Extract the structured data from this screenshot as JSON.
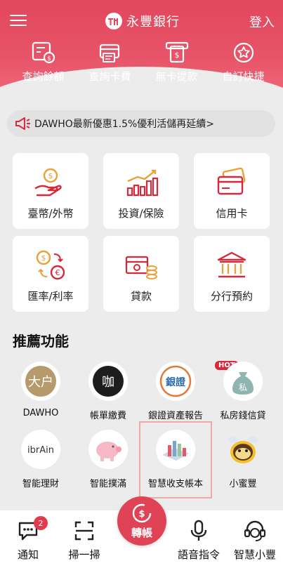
{
  "header": {
    "brand_name": "永豐銀行",
    "login_label": "登入",
    "icons": {
      "menu": "hamburger-menu-icon",
      "logo": "bank-logo-icon"
    }
  },
  "quick_actions": [
    {
      "label": "查詢餘額",
      "icon": "balance-coins-icon"
    },
    {
      "label": "查詢卡費",
      "icon": "card-bill-icon"
    },
    {
      "label": "無卡提款",
      "icon": "cardless-atm-icon"
    },
    {
      "label": "自訂快捷",
      "icon": "star-shortcut-icon"
    }
  ],
  "notice": {
    "text": "DAWHO最新優惠1.5%優利活儲再延續>",
    "icon": "megaphone-icon"
  },
  "services": [
    {
      "label": "臺幣/外幣",
      "icon": "hand-coin-icon"
    },
    {
      "label": "投資/保險",
      "icon": "bar-chart-growth-icon"
    },
    {
      "label": "信用卡",
      "icon": "credit-card-icon"
    },
    {
      "label": "匯率/利率",
      "icon": "currency-exchange-icon"
    },
    {
      "label": "貸款",
      "icon": "cash-stack-icon"
    },
    {
      "label": "分行預約",
      "icon": "bank-building-icon"
    }
  ],
  "recommended": {
    "title": "推薦功能",
    "hot_badge": "HOT",
    "items": [
      {
        "label": "DAWHO",
        "icon": "dawho-icon",
        "icon_text": "大户"
      },
      {
        "label": "帳單繳費",
        "icon": "bill-payment-icon",
        "icon_text": "咖"
      },
      {
        "label": "銀證資產報告",
        "icon": "bank-securities-icon",
        "icon_text": "銀證"
      },
      {
        "label": "私房錢信貸",
        "icon": "money-bag-icon",
        "icon_text": "私"
      },
      {
        "label": "智能理財",
        "icon": "ibrain-icon",
        "icon_text": "ibrAin"
      },
      {
        "label": "智能撲滿",
        "icon": "piggy-bank-icon"
      },
      {
        "label": "智慧收支帳本",
        "icon": "ledger-chart-icon"
      },
      {
        "label": "小蜜豐",
        "icon": "bee-mascot-icon"
      }
    ]
  },
  "tabbar": {
    "items": [
      {
        "label": "通知",
        "icon": "chat-notification-icon",
        "badge": "2"
      },
      {
        "label": "掃一掃",
        "icon": "scan-icon"
      },
      {
        "label": "轉帳",
        "icon": "transfer-icon"
      },
      {
        "label": "語音指令",
        "icon": "microphone-icon"
      },
      {
        "label": "智慧小豐",
        "icon": "assistant-headset-icon"
      }
    ]
  },
  "colors": {
    "brand_red": "#e2475c",
    "accent_red": "#d8283a",
    "background": "#ececec",
    "highlight_border": "#f0a8a8"
  }
}
